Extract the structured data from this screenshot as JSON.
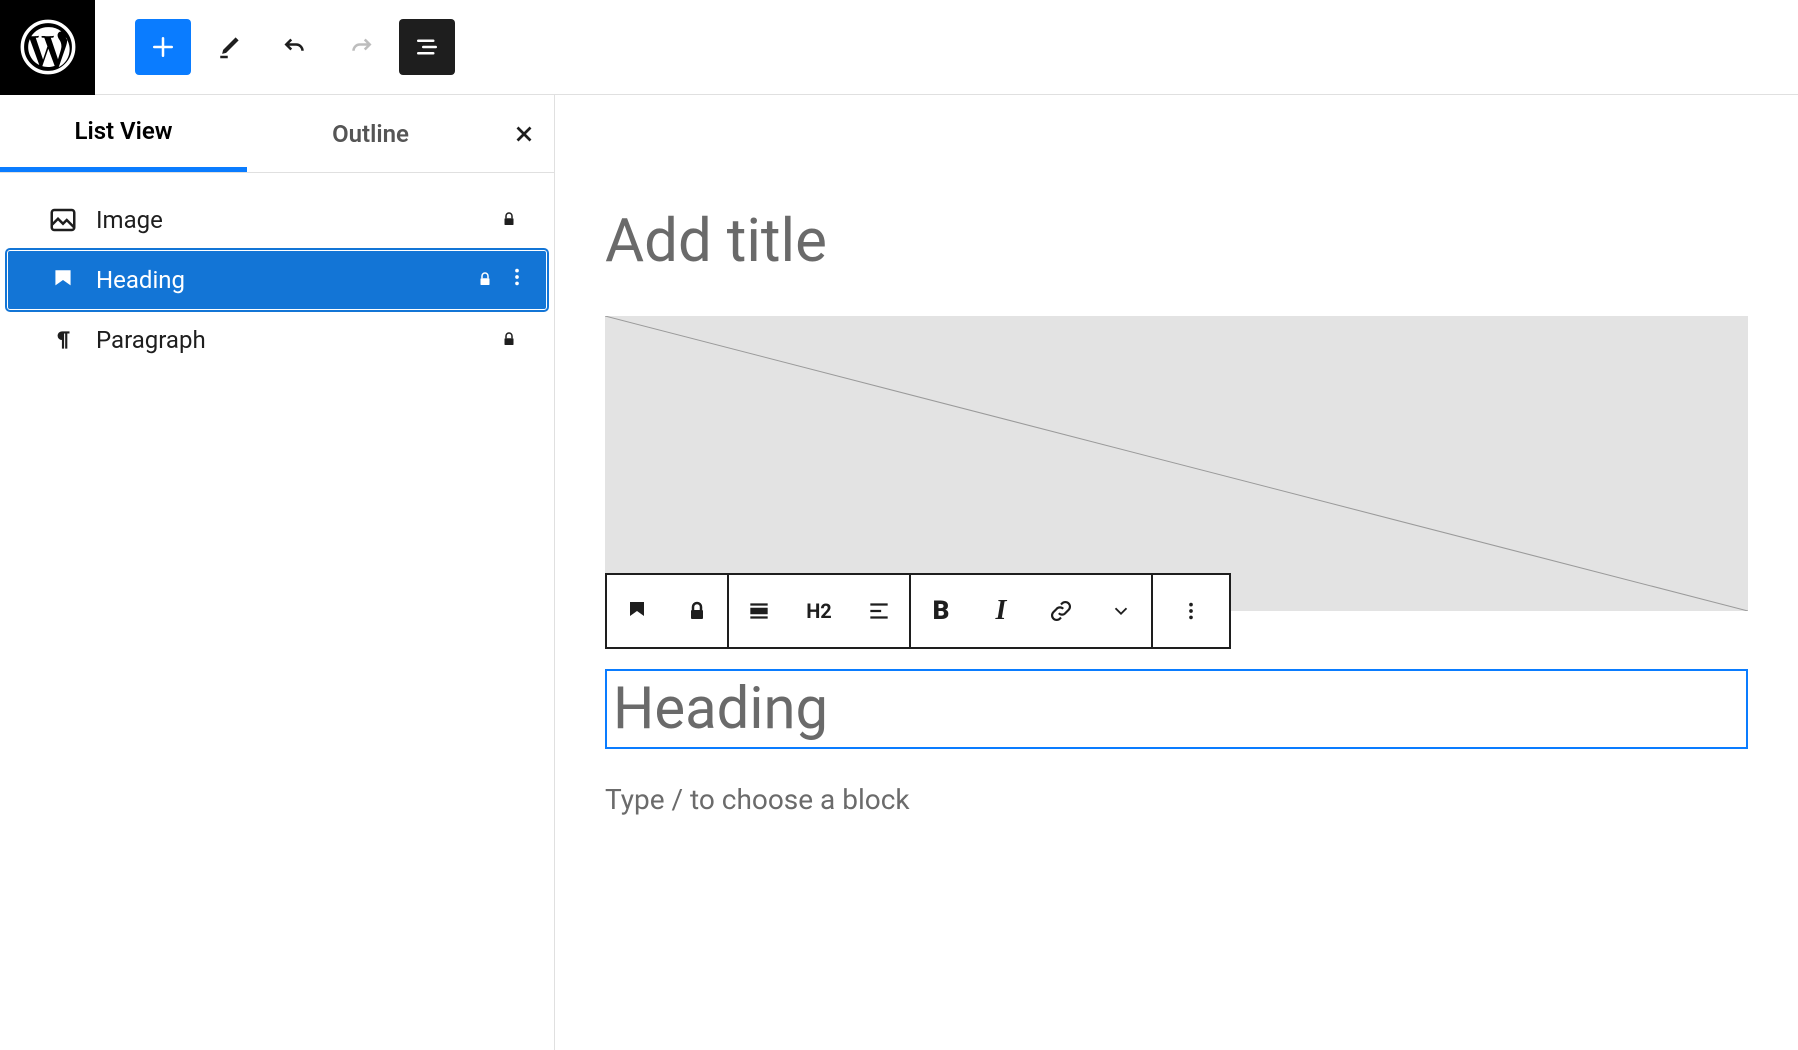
{
  "toolbar": {
    "add_label": "Add block",
    "tools_label": "Tools",
    "undo_label": "Undo",
    "redo_label": "Redo",
    "listview_label": "List View"
  },
  "sidebar": {
    "tabs": {
      "listview": "List View",
      "outline": "Outline"
    },
    "blocks": [
      {
        "type": "image",
        "label": "Image",
        "locked": true,
        "selected": false
      },
      {
        "type": "heading",
        "label": "Heading",
        "locked": true,
        "selected": true
      },
      {
        "type": "paragraph",
        "label": "Paragraph",
        "locked": true,
        "selected": false
      }
    ]
  },
  "content": {
    "title_placeholder": "Add title",
    "heading_placeholder": "Heading",
    "paragraph_placeholder": "Type / to choose a block",
    "heading_level": "H2"
  }
}
